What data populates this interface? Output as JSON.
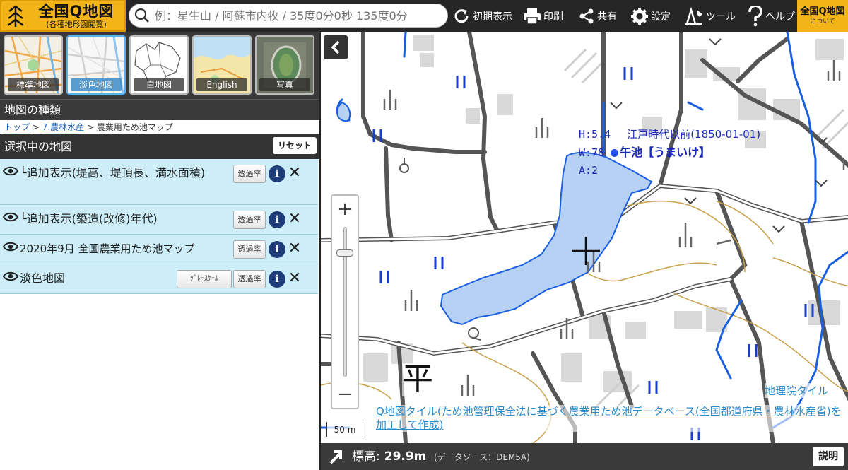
{
  "app": {
    "logo_title": "全国Q地図",
    "logo_subtitle": "(各種地形図閲覧)",
    "about_title": "全国Q地図",
    "about_sub": "について"
  },
  "search": {
    "placeholder": "例：星生山 / 阿蘇市内牧 / 35度0分0秒 135度0分"
  },
  "toolbar": {
    "home_label": "初期表示",
    "print_label": "印刷",
    "share_label": "共有",
    "settings_label": "設定",
    "tools_label": "ツール",
    "help_label": "ヘルプ"
  },
  "basemaps": [
    {
      "label": "標準地図"
    },
    {
      "label": "淡色地図"
    },
    {
      "label": "白地図"
    },
    {
      "label": "English"
    },
    {
      "label": "写真"
    }
  ],
  "sidebar": {
    "map_type_header": "地図の種類",
    "breadcrumb": {
      "top": "トップ",
      "sep1": ">",
      "category": "7.農林水産",
      "sep2": ">",
      "current": "農業用ため池マップ"
    },
    "selected_header": "選択中の地図",
    "reset_label": "リセット"
  },
  "layers": [
    {
      "name": "└追加表示(堤高、堤頂長、満水面積)",
      "opacity_label": "透過率"
    },
    {
      "name": "└追加表示(築造(改修)年代)",
      "opacity_label": "透過率"
    },
    {
      "name": "2020年9月 全国農業用ため池マップ",
      "opacity_label": "透過率"
    },
    {
      "name": "淡色地図",
      "grayscale_label": "ｸﾞﾚｰｽｹｰﾙ",
      "opacity_label": "透過率"
    }
  ],
  "map": {
    "zoom_in": "+",
    "zoom_out": "−",
    "scale": "50 m",
    "place_char": "平",
    "pond_info": {
      "h_line": "H:5.4",
      "era": "江戸時代以前(1850-01-01)",
      "w_line": "W:78",
      "name": "午池【うまいけ】",
      "a_line": "A:2"
    },
    "attribution_tile": "地理院タイル",
    "attribution_link": "Q地図タイル",
    "attribution_text": "(ため池管理保全法に基づく農業用ため池データベース(全国都道府県・農林水産省)を加工して作成)"
  },
  "bottom": {
    "elevation_label": "標高:",
    "elevation_value": "29.9m",
    "source": "(データソース：DEM5A)",
    "explain_label": "説明"
  },
  "colors": {
    "logo_bg": "#f2b417",
    "layer_bg": "#cdeef8",
    "info_btn": "#1d3c78",
    "pond_fill": "#b7d1f5",
    "water_line": "#1a5fe0",
    "label_blue": "#1b2bb8",
    "attribution": "#2a8ac8"
  }
}
